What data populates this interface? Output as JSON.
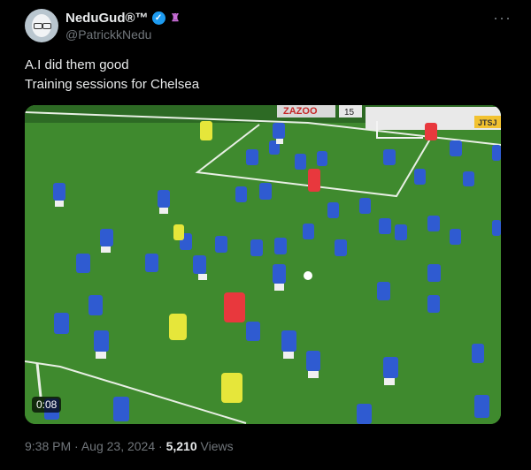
{
  "author": {
    "display_name": "NeduGud®™",
    "handle": "@PatrickkNedu"
  },
  "tweet": {
    "lines": [
      "A.I did them good",
      "Training sessions for Chelsea"
    ]
  },
  "media": {
    "duration": "0:08",
    "board_texts": [
      "ZAZOO",
      "15",
      "JTSJ"
    ]
  },
  "meta": {
    "time": "9:38 PM",
    "sep1": "·",
    "date": "Aug 23, 2024",
    "sep2": "·",
    "views_count": "5,210",
    "views_label": "Views"
  },
  "colors": {
    "background": "#000000",
    "verified": "#1d9bf0",
    "pitch": "#3f8a2e",
    "kit_blue": "#2f5bd1"
  }
}
